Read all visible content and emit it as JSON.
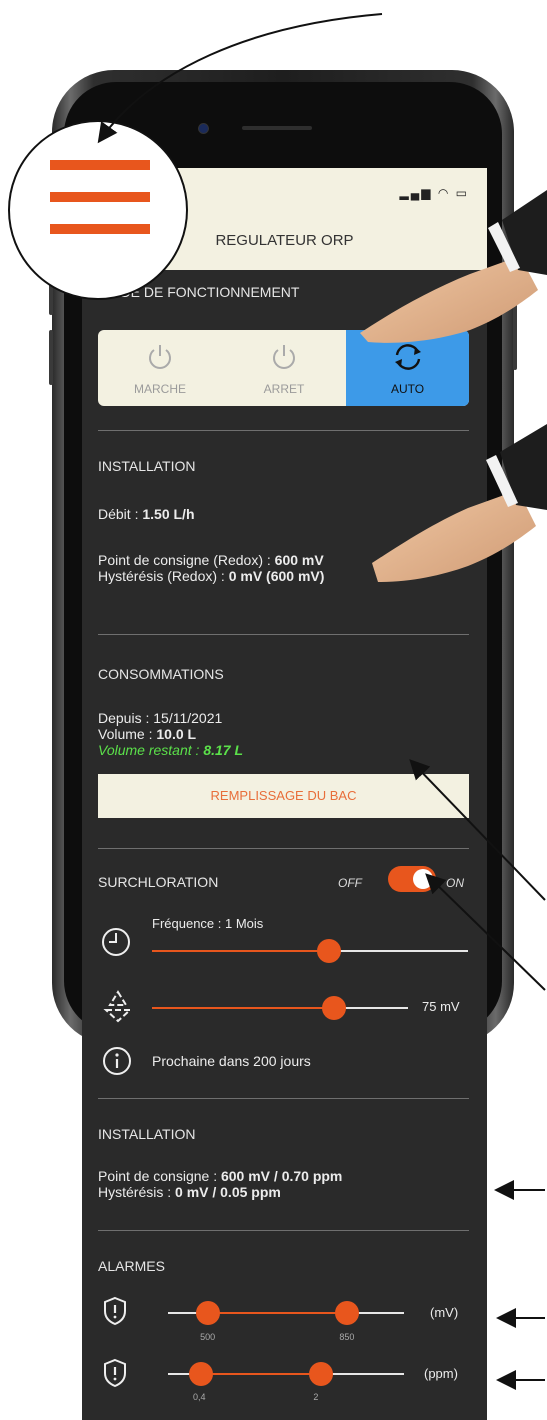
{
  "app": {
    "title": "REGULATEUR ORP"
  },
  "mode": {
    "header": "MODE DE FONCTIONNEMENT",
    "buttons": [
      {
        "label": "MARCHE",
        "icon": "power-icon"
      },
      {
        "label": "ARRET",
        "icon": "power-icon"
      },
      {
        "label": "AUTO",
        "icon": "refresh-icon",
        "active": true
      }
    ],
    "accent": "#3d9ae8"
  },
  "installation1": {
    "header": "INSTALLATION",
    "debit_label": "Débit : ",
    "debit_value": "1.50 L/h",
    "consigne_label": "Point de consigne (Redox) : ",
    "consigne_value": "600 mV",
    "hysteresis_label": "Hystérésis (Redox) : ",
    "hysteresis_value": "0 mV (600 mV)"
  },
  "consommations": {
    "header": "CONSOMMATIONS",
    "depuis_label": "Depuis : ",
    "depuis_value": "15/11/2021",
    "volume_label": "Volume : ",
    "volume_value": "10.0 L",
    "restant_label": "Volume restant : ",
    "restant_value": "8.17 L",
    "fill_button": "REMPLISSAGE DU BAC"
  },
  "surchloration": {
    "header": "SURCHLORATION",
    "off_label": "OFF",
    "on_label": "ON",
    "enabled": true,
    "frequency_label": "Fréquence : 1 Mois",
    "frequency_position": 0.56,
    "level_position": 0.71,
    "level_value": "75 mV",
    "next_label": "Prochaine dans 200 jours"
  },
  "installation2": {
    "header": "INSTALLATION",
    "consigne_label": "Point de consigne : ",
    "consigne_value": "600 mV / 0.70 ppm",
    "hysteresis_label": "Hystérésis : ",
    "hysteresis_value": "0 mV / 0.05 ppm"
  },
  "alarmes": {
    "header": "ALARMES",
    "mv": {
      "unit": "(mV)",
      "low": "500",
      "high": "850",
      "low_pos": 0.17,
      "high_pos": 0.76
    },
    "ppm": {
      "unit": "(ppm)",
      "low": "0,4",
      "high": "2",
      "low_pos": 0.14,
      "high_pos": 0.65
    }
  },
  "colors": {
    "accent_orange": "#e8561d",
    "cream": "#f3f1e1",
    "dark_bg": "#2a2a2a",
    "green": "#5be04a"
  }
}
